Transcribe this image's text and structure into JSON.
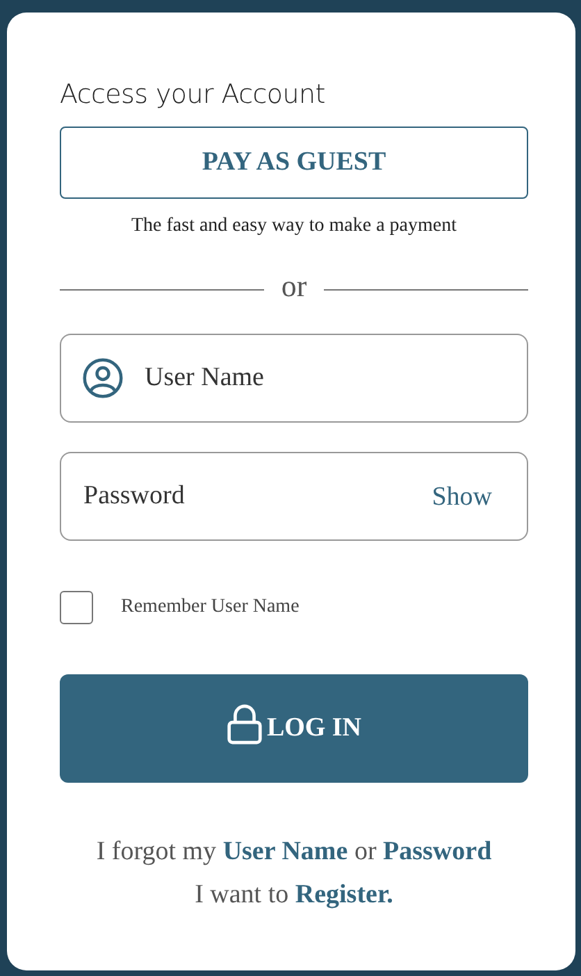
{
  "heading": "Access your Account",
  "guest_button": {
    "label": "PAY AS GUEST"
  },
  "guest_caption": "The fast and easy way to make a payment",
  "divider_text": "or",
  "username_field": {
    "placeholder": "User Name"
  },
  "password_field": {
    "placeholder": "Password",
    "toggle": "Show"
  },
  "remember": {
    "label": "Remember User Name",
    "checked": false
  },
  "login_button": {
    "label": "LOG IN"
  },
  "help_lines": [
    {
      "parts": [
        {
          "kind": "plain",
          "text": "I forgot my "
        },
        {
          "kind": "link",
          "text": "User Name"
        },
        {
          "kind": "plain",
          "text": " or "
        },
        {
          "kind": "link",
          "text": "Password"
        }
      ]
    },
    {
      "parts": [
        {
          "kind": "plain",
          "text": "I want to "
        },
        {
          "kind": "link",
          "text": "Register."
        }
      ]
    }
  ]
}
